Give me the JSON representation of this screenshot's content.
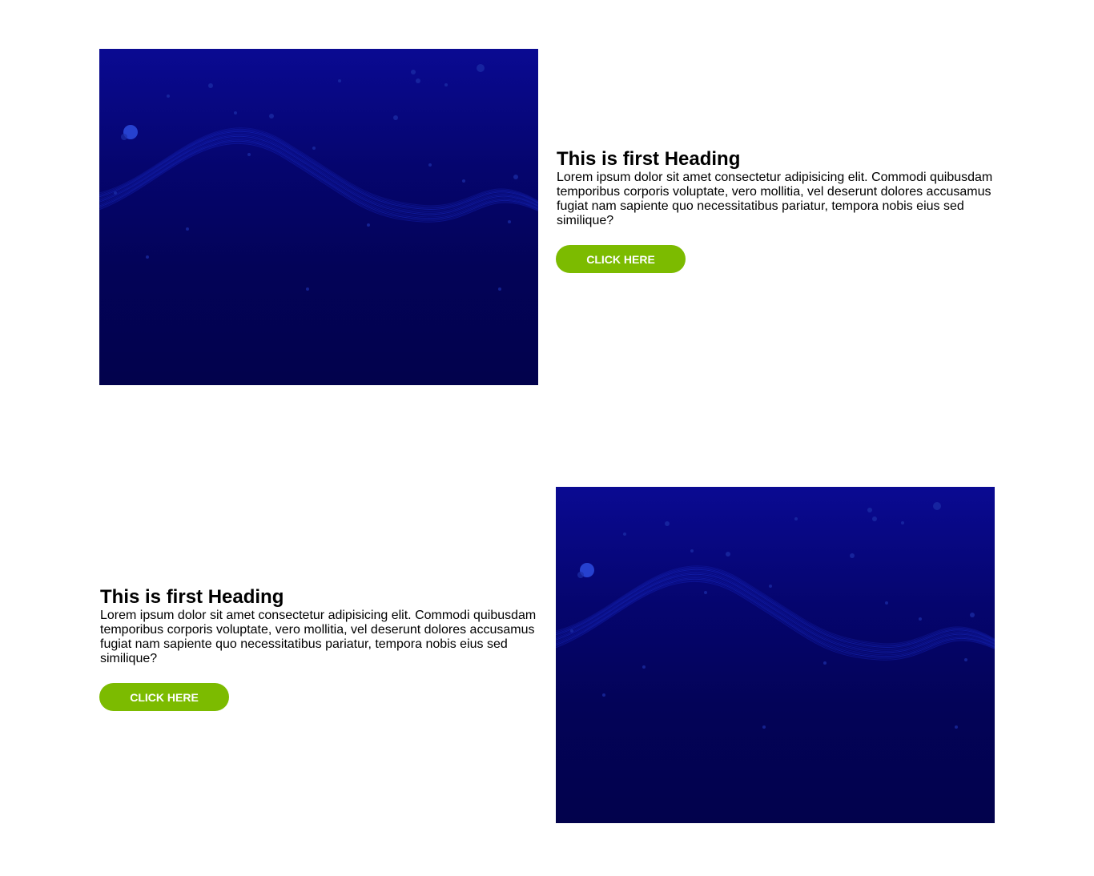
{
  "colors": {
    "button_bg": "#7cbb00",
    "button_text": "#ffffff",
    "image_top": "#0a0a92",
    "image_bottom": "#02024c",
    "wave": "#1a2fd0"
  },
  "sections": [
    {
      "heading": "This is first Heading",
      "paragraph": "Lorem ipsum dolor sit amet consectetur adipisicing elit. Commodi quibusdam temporibus corporis voluptate, vero mollitia, vel deserunt dolores accusamus fugiat nam sapiente quo necessitatibus pariatur, tempora nobis eius sed similique?",
      "button_label": "CLICK HERE",
      "image_icon": "abstract-wave-background-image"
    },
    {
      "heading": "This is first Heading",
      "paragraph": "Lorem ipsum dolor sit amet consectetur adipisicing elit. Commodi quibusdam temporibus corporis voluptate, vero mollitia, vel deserunt dolores accusamus fugiat nam sapiente quo necessitatibus pariatur, tempora nobis eius sed similique?",
      "button_label": "CLICK HERE",
      "image_icon": "abstract-wave-background-image"
    }
  ]
}
